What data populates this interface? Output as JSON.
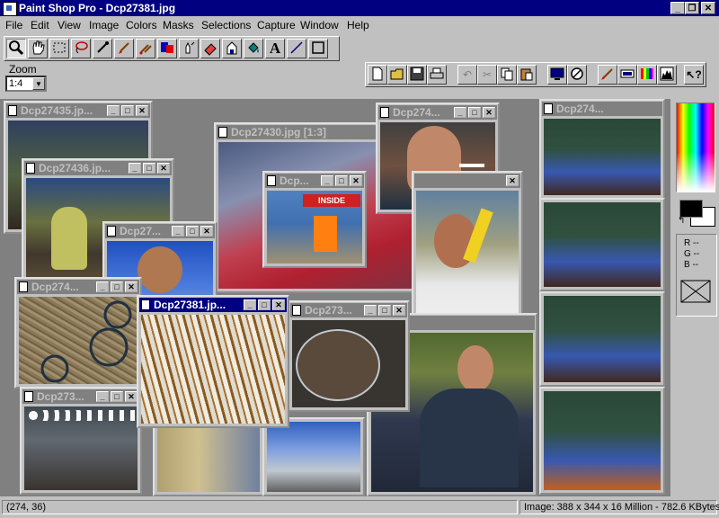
{
  "window": {
    "title": "Paint Shop Pro - Dcp27381.jpg"
  },
  "menu": [
    "File",
    "Edit",
    "View",
    "Image",
    "Colors",
    "Masks",
    "Selections",
    "Capture",
    "Window",
    "Help"
  ],
  "zoom": {
    "label": "Zoom",
    "value": "1:4"
  },
  "toolbar1": [
    "zoom-tool-icon",
    "pan-tool-icon",
    "rect-select-icon",
    "lasso-icon",
    "eyedropper-icon",
    "paintbrush-icon",
    "clone-brush-icon",
    "color-replacer-icon",
    "retouch-icon",
    "eraser-icon",
    "picture-tube-icon",
    "flood-fill-icon",
    "text-tool-icon",
    "line-tool-icon",
    "shape-tool-icon"
  ],
  "toolbar2": [
    "new-file-icon",
    "open-file-icon",
    "save-icon",
    "print-icon",
    "undo-icon",
    "cut-icon",
    "copy-icon",
    "paste-icon",
    "full-screen-icon",
    "normal-viewing-icon",
    "toggle-tool-palette-icon",
    "toggle-style-bar-icon",
    "toggle-color-palette-icon",
    "histogram-icon",
    "help-icon"
  ],
  "text_tool_glyph": "A",
  "windows": [
    {
      "id": "w1",
      "title": "Dcp27435.jp...",
      "active": false
    },
    {
      "id": "w2",
      "title": "Dcp27436.jp...",
      "active": false
    },
    {
      "id": "w3",
      "title": "Dcp27...",
      "active": false
    },
    {
      "id": "w4",
      "title": "Dcp274...",
      "active": false
    },
    {
      "id": "w5",
      "title": "Dcp27430.jpg [1:3]",
      "active": false
    },
    {
      "id": "w6",
      "title": "Dcp...",
      "active": false
    },
    {
      "id": "w7",
      "title": "Dcp274...",
      "active": false
    },
    {
      "id": "w8",
      "title": "Dcp274...",
      "active": false
    },
    {
      "id": "w9",
      "title": "Dcp27381.jp...",
      "active": true
    },
    {
      "id": "w10",
      "title": "Dcp273...",
      "active": false
    },
    {
      "id": "w11",
      "title": "Dcp273...",
      "active": false
    }
  ],
  "sign_text": "INSIDE",
  "palette": {
    "fg": "#000000",
    "bg": "#ffffff",
    "rgb": [
      "R --",
      "G --",
      "B --"
    ]
  },
  "status": {
    "coords": "(274, 36)",
    "info": "Image:  388 x 344 x 16 Million - 782.6 KBytes"
  }
}
